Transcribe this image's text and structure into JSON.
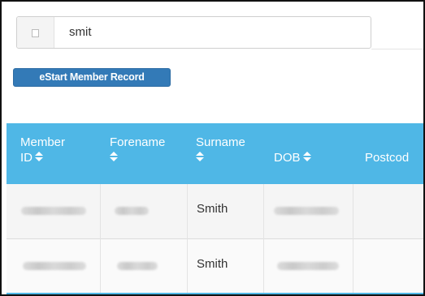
{
  "search": {
    "value": "smit",
    "icon": "square-outline-icon"
  },
  "actions": {
    "estart_label": "eStart Member Record"
  },
  "table": {
    "columns": [
      {
        "line1": "Member",
        "line2": "ID"
      },
      {
        "line1": "Forename",
        "line2": ""
      },
      {
        "line1": "Surname",
        "line2": ""
      },
      {
        "line1": "",
        "line2": "DOB"
      },
      {
        "line1": "",
        "line2": "Postcod"
      }
    ],
    "rows": [
      {
        "surname": "Smith"
      },
      {
        "surname": "Smith"
      }
    ]
  },
  "colors": {
    "header_bg": "#4fb7e6",
    "button_bg": "#337ab7"
  }
}
